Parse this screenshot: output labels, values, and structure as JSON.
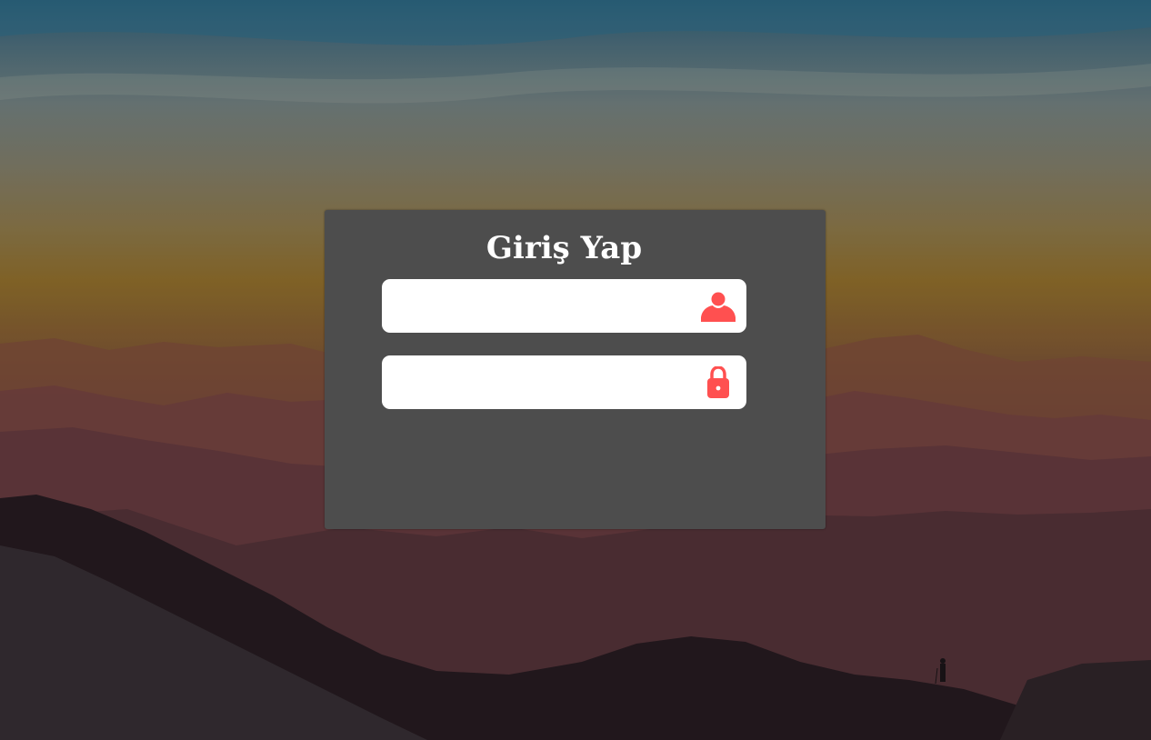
{
  "login": {
    "title": "Giriş Yap",
    "username": {
      "value": "",
      "placeholder": "",
      "icon": "user-icon"
    },
    "password": {
      "value": "",
      "placeholder": "",
      "icon": "lock-icon"
    }
  },
  "colors": {
    "card_background": "#4d4d4d",
    "field_background": "#ffffff",
    "icon_accent": "#ff5050",
    "title_text": "#ffffff"
  }
}
